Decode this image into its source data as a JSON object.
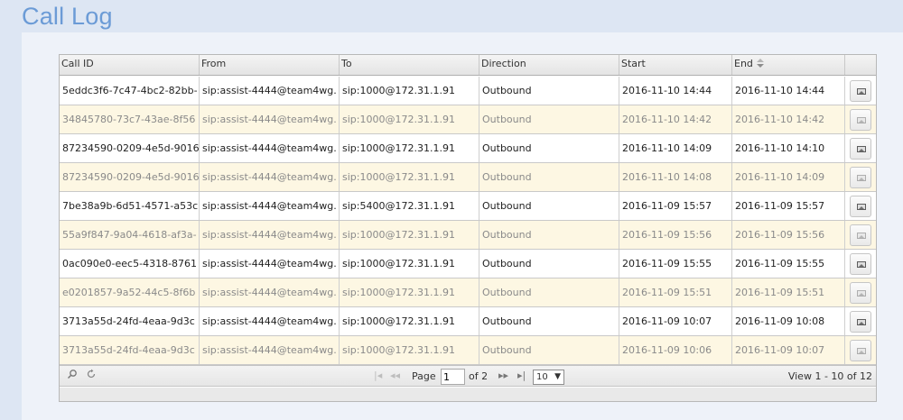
{
  "page": {
    "title": "Call Log"
  },
  "table": {
    "columns": [
      {
        "label": "Call ID"
      },
      {
        "label": "From"
      },
      {
        "label": "To"
      },
      {
        "label": "Direction"
      },
      {
        "label": "Start"
      },
      {
        "label": "End",
        "sort_icon": "sort-icon"
      },
      {
        "label": ""
      }
    ],
    "rows": [
      {
        "call_id": "5eddc3f6-7c47-4bc2-82bb-",
        "from": "sip:assist-4444@team4wg.",
        "to": "sip:1000@172.31.1.91",
        "direction": "Outbound",
        "start": "2016-11-10 14:44",
        "end": "2016-11-10 14:44"
      },
      {
        "call_id": "34845780-73c7-43ae-8f56",
        "from": "sip:assist-4444@team4wg.",
        "to": "sip:1000@172.31.1.91",
        "direction": "Outbound",
        "start": "2016-11-10 14:42",
        "end": "2016-11-10 14:42"
      },
      {
        "call_id": "87234590-0209-4e5d-9016",
        "from": "sip:assist-4444@team4wg.",
        "to": "sip:1000@172.31.1.91",
        "direction": "Outbound",
        "start": "2016-11-10 14:09",
        "end": "2016-11-10 14:10"
      },
      {
        "call_id": "87234590-0209-4e5d-9016",
        "from": "sip:assist-4444@team4wg.",
        "to": "sip:1000@172.31.1.91",
        "direction": "Outbound",
        "start": "2016-11-10 14:08",
        "end": "2016-11-10 14:09"
      },
      {
        "call_id": "7be38a9b-6d51-4571-a53c",
        "from": "sip:assist-4444@team4wg.",
        "to": "sip:5400@172.31.1.91",
        "direction": "Outbound",
        "start": "2016-11-09 15:57",
        "end": "2016-11-09 15:57"
      },
      {
        "call_id": "55a9f847-9a04-4618-af3a-",
        "from": "sip:assist-4444@team4wg.",
        "to": "sip:1000@172.31.1.91",
        "direction": "Outbound",
        "start": "2016-11-09 15:56",
        "end": "2016-11-09 15:56"
      },
      {
        "call_id": "0ac090e0-eec5-4318-8761",
        "from": "sip:assist-4444@team4wg.",
        "to": "sip:1000@172.31.1.91",
        "direction": "Outbound",
        "start": "2016-11-09 15:55",
        "end": "2016-11-09 15:55"
      },
      {
        "call_id": "e0201857-9a52-44c5-8f6b",
        "from": "sip:assist-4444@team4wg.",
        "to": "sip:1000@172.31.1.91",
        "direction": "Outbound",
        "start": "2016-11-09 15:51",
        "end": "2016-11-09 15:51"
      },
      {
        "call_id": "3713a55d-24fd-4eaa-9d3c",
        "from": "sip:assist-4444@team4wg.",
        "to": "sip:1000@172.31.1.91",
        "direction": "Outbound",
        "start": "2016-11-09 10:07",
        "end": "2016-11-09 10:08"
      },
      {
        "call_id": "3713a55d-24fd-4eaa-9d3c",
        "from": "sip:assist-4444@team4wg.",
        "to": "sip:1000@172.31.1.91",
        "direction": "Outbound",
        "start": "2016-11-09 10:06",
        "end": "2016-11-09 10:07"
      }
    ],
    "row_action_icon": "image-icon"
  },
  "pager": {
    "search_icon": "search-icon",
    "refresh_icon": "refresh-icon",
    "first_label": "|◂",
    "prev_label": "◂◂",
    "next_label": "▸▸",
    "last_label": "▸|",
    "page_label": "Page",
    "page_value": "1",
    "of_label": "of 2",
    "rows_per_page": "10",
    "view_text": "View 1 - 10 of 12"
  }
}
